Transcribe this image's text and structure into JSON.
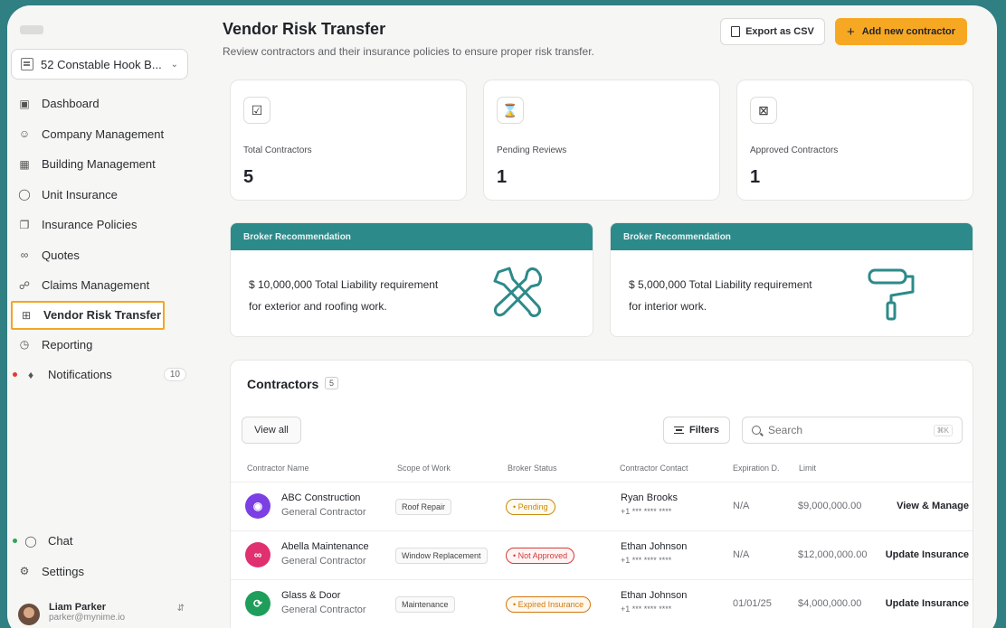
{
  "sidebar": {
    "property": "52 Constable Hook B...",
    "items": [
      {
        "label": "Dashboard",
        "icon": "dashboard-icon"
      },
      {
        "label": "Company Management",
        "icon": "users-icon"
      },
      {
        "label": "Building Management",
        "icon": "building-icon"
      },
      {
        "label": "Unit Insurance",
        "icon": "shield-icon"
      },
      {
        "label": "Insurance Policies",
        "icon": "policies-icon"
      },
      {
        "label": "Quotes",
        "icon": "paperclip-icon"
      },
      {
        "label": "Claims Management",
        "icon": "claims-icon"
      },
      {
        "label": "Vendor Risk Transfer",
        "icon": "vendor-icon",
        "active": true
      },
      {
        "label": "Reporting",
        "icon": "clock-icon"
      },
      {
        "label": "Notifications",
        "icon": "bell-icon",
        "badge": "10"
      }
    ],
    "bottom": [
      {
        "label": "Chat",
        "icon": "chat-icon"
      },
      {
        "label": "Settings",
        "icon": "gear-icon"
      }
    ],
    "user": {
      "name": "Liam Parker",
      "email": "parker@mynime.io"
    }
  },
  "header": {
    "title": "Vendor Risk Transfer",
    "subtitle": "Review contractors and their insurance policies to ensure proper risk transfer.",
    "export_label": "Export as CSV",
    "add_label": "Add new contractor"
  },
  "stats": [
    {
      "label": "Total Contractors",
      "value": "5",
      "icon": "checkbox-icon"
    },
    {
      "label": "Pending Reviews",
      "value": "1",
      "icon": "hourglass-icon"
    },
    {
      "label": "Approved Contractors",
      "value": "1",
      "icon": "x-box-icon"
    }
  ],
  "recommendations": [
    {
      "header": "Broker Recommendation",
      "line1": "$ 10,000,000 Total Liability requirement",
      "line2": "for exterior and roofing work.",
      "icon": "tools-icon"
    },
    {
      "header": "Broker Recommendation",
      "line1": "$ 5,000,000 Total Liability requirement",
      "line2": "for interior work.",
      "icon": "paint-roller-icon"
    }
  ],
  "contractors": {
    "title": "Contractors",
    "count": "5",
    "view_all": "View all",
    "filters": "Filters",
    "search_placeholder": "Search",
    "search_shortcut": "⌘K",
    "columns": [
      "Contractor Name",
      "Scope of Work",
      "Broker Status",
      "Contractor Contact",
      "Expiration D.",
      "Limit"
    ],
    "rows": [
      {
        "name": "ABC Construction",
        "role": "General Contractor",
        "scope": "Roof Repair",
        "status": "• Pending",
        "contact": "Ryan Brooks",
        "phone": "+1 *** **** ****",
        "expiration": "N/A",
        "limit": "$9,000,000.00",
        "action": "View & Manage",
        "color": "#7b3fe4"
      },
      {
        "name": "Abella Maintenance",
        "role": "General Contractor",
        "scope": "Window Replacement",
        "status": "• Not Approved",
        "contact": "Ethan Johnson",
        "phone": "+1 *** **** ****",
        "expiration": "N/A",
        "limit": "$12,000,000.00",
        "action": "Update Insurance",
        "color": "#e0306f"
      },
      {
        "name": "Glass & Door",
        "role": "General Contractor",
        "scope": "Maintenance",
        "status": "• Expired Insurance",
        "contact": "Ethan Johnson",
        "phone": "+1 *** **** ****",
        "expiration": "01/01/25",
        "limit": "$4,000,000.00",
        "action": "Update Insurance",
        "color": "#1e9e5a"
      }
    ]
  }
}
